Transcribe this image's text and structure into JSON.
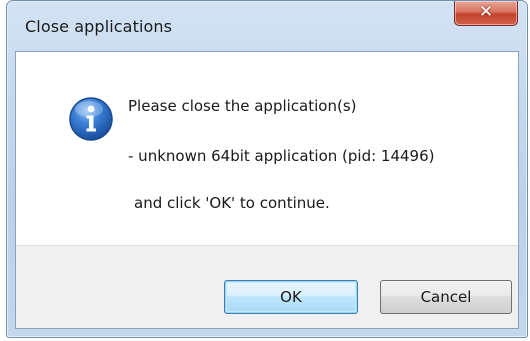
{
  "window": {
    "title": "Close applications",
    "close_glyph": "✕"
  },
  "dialog": {
    "icon": "info-icon",
    "line1": "Please close the application(s)",
    "line2": "- unknown 64bit application (pid: 14496)",
    "line3": " and click 'OK' to continue."
  },
  "buttons": {
    "ok_label": "OK",
    "cancel_label": "Cancel"
  },
  "colors": {
    "titlebar": "#c5d8ee",
    "close_button": "#c2432b",
    "default_button_border": "#3c7fb1",
    "info_icon": "#1f5fb8"
  }
}
